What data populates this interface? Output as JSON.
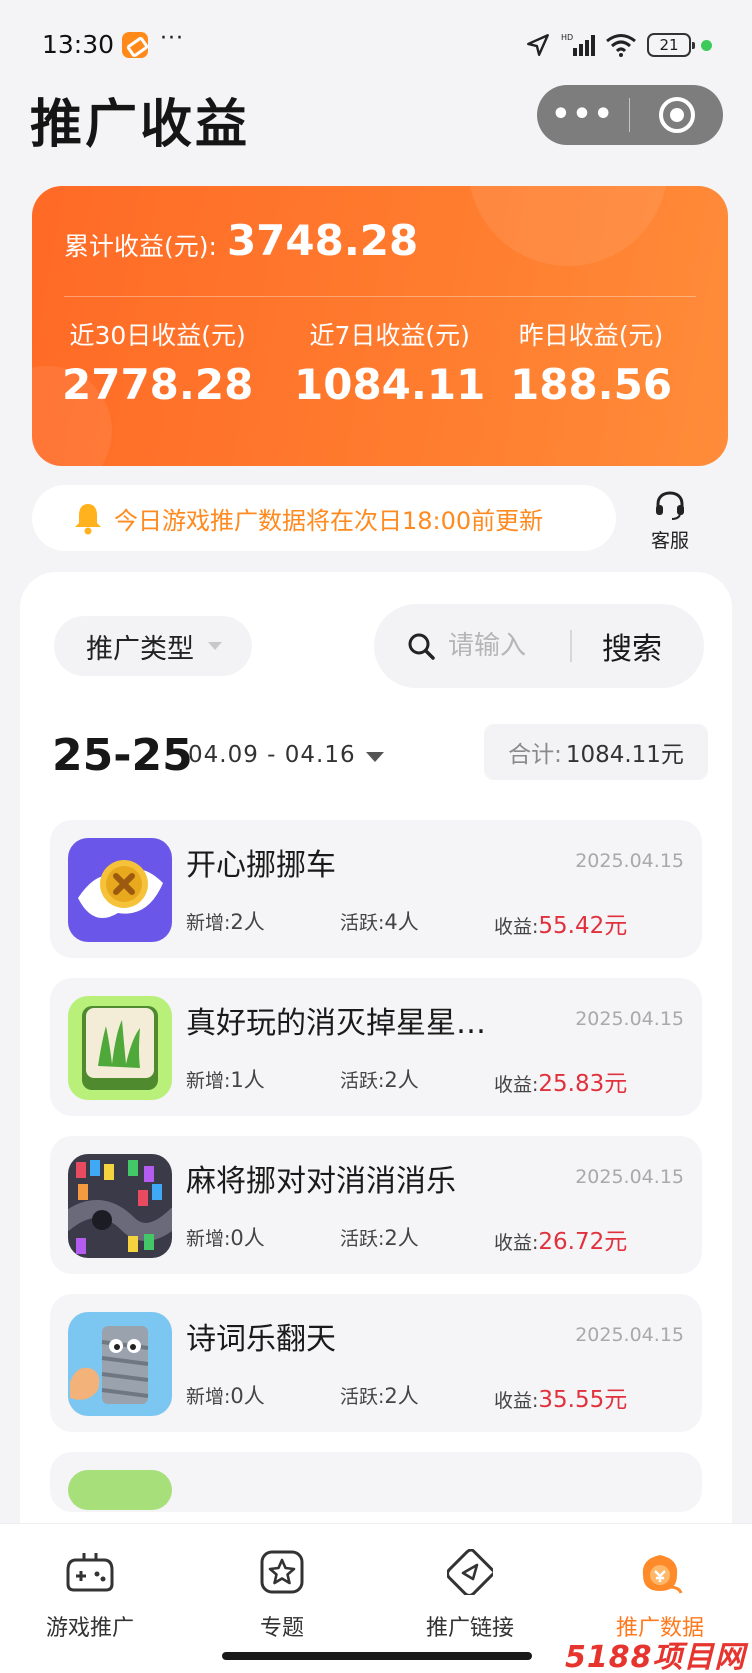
{
  "status_bar": {
    "time": "13:30",
    "more": "···",
    "network": "HD",
    "battery": "21"
  },
  "header": {
    "title": "推广收益",
    "capsule_more": "•••"
  },
  "earnings": {
    "total_label": "累计收益(元):",
    "total_value": "3748.28",
    "stats": [
      {
        "label": "近30日收益(元)",
        "value": "2778.28"
      },
      {
        "label": "近7日收益(元)",
        "value": "1084.11"
      },
      {
        "label": "昨日收益(元)",
        "value": "188.56"
      }
    ]
  },
  "notice": {
    "text": "今日游戏推广数据将在次日18:00前更新",
    "service_label": "客服"
  },
  "filters": {
    "type_label": "推广类型",
    "search_placeholder": "请输入",
    "search_button": "搜索"
  },
  "range": {
    "big": "25-25",
    "dates": "04.09 - 04.16",
    "total_key": "合计:",
    "total_value": "1084.11元"
  },
  "games": [
    {
      "name": "开心挪挪车",
      "date": "2025.04.15",
      "new_label": "新增:",
      "new_value": "2人",
      "active_label": "活跃:",
      "active_value": "4人",
      "earn_label": "收益:",
      "earn_value": "55.42元"
    },
    {
      "name": "真好玩的消灭掉星星…",
      "date": "2025.04.15",
      "new_label": "新增:",
      "new_value": "1人",
      "active_label": "活跃:",
      "active_value": "2人",
      "earn_label": "收益:",
      "earn_value": "25.83元"
    },
    {
      "name": "麻将挪对对消消消乐",
      "date": "2025.04.15",
      "new_label": "新增:",
      "new_value": "0人",
      "active_label": "活跃:",
      "active_value": "2人",
      "earn_label": "收益:",
      "earn_value": "26.72元"
    },
    {
      "name": "诗词乐翻天",
      "date": "2025.04.15",
      "new_label": "新增:",
      "new_value": "0人",
      "active_label": "活跃:",
      "active_value": "2人",
      "earn_label": "收益:",
      "earn_value": "35.55元"
    }
  ],
  "tabs": [
    {
      "label": "游戏推广",
      "icon": "gamepad-icon"
    },
    {
      "label": "专题",
      "icon": "star-icon"
    },
    {
      "label": "推广链接",
      "icon": "link-icon"
    },
    {
      "label": "推广数据",
      "icon": "data-icon",
      "active": true
    }
  ],
  "watermark": "5188项目网",
  "colors": {
    "accent": "#ff7a1f",
    "earn": "#e0313d",
    "card": "#ff6a26"
  }
}
